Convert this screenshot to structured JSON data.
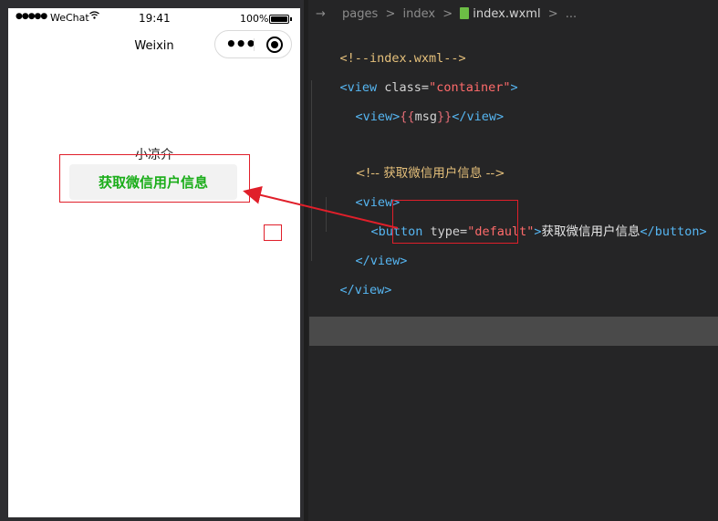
{
  "status_bar": {
    "signal": "●●●●●",
    "carrier": "WeChat",
    "time": "19:41",
    "battery": "100%"
  },
  "navbar": {
    "title": "Weixin"
  },
  "page": {
    "msg": "小凉介",
    "button_label": "获取微信用户信息"
  },
  "breadcrumb": {
    "arrow": "→",
    "items": [
      "pages",
      "index",
      "index.wxml",
      "..."
    ],
    "separator": ">"
  },
  "code": {
    "l1": "<!--index.wxml-->",
    "l2_open": "<view",
    "l2_attr": " class=",
    "l2_val": "\"container\"",
    "l2_close": ">",
    "l3_open": "<view>",
    "l3_brace_open": "{{",
    "l3_var": "msg",
    "l3_brace_close": "}}",
    "l3_close": "</view>",
    "l4": "<!-- 获取微信用户信息 -->",
    "l5": "<view>",
    "l6_open": "<button",
    "l6_attr": " type=",
    "l6_val": "\"default\"",
    "l6_gt": ">",
    "l6_text": "获取微信用户信息",
    "l6_close": "</button>",
    "l7": "</view>",
    "l8": "</view>"
  },
  "colors": {
    "annotation": "#e01f2a",
    "button_text": "#1aad19"
  }
}
